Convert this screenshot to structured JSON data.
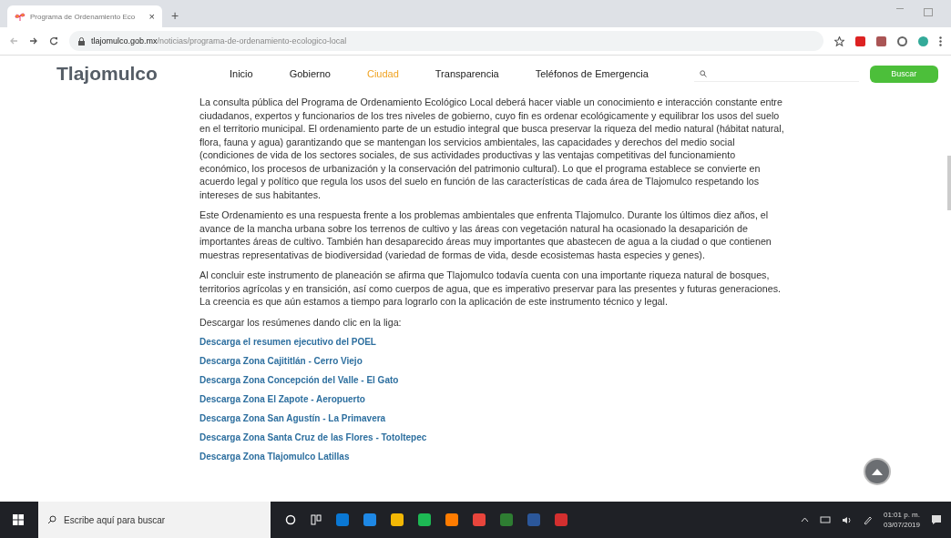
{
  "browser": {
    "tab_title": "Programa de Ordenamiento Eco",
    "tab_close": "×",
    "new_tab": "+",
    "url_domain": "tlajomulco.gob.mx",
    "url_path": "/noticias/programa-de-ordenamiento-ecologico-local"
  },
  "header": {
    "logo": "Tlajomulco",
    "nav": [
      {
        "label": "Inicio",
        "selected": false
      },
      {
        "label": "Gobierno",
        "selected": false
      },
      {
        "label": "Ciudad",
        "selected": true
      },
      {
        "label": "Transparencia",
        "selected": false
      },
      {
        "label": "Teléfonos de Emergencia",
        "selected": false
      }
    ],
    "search_button": "Buscar"
  },
  "article": {
    "paragraphs": [
      " La consulta pública del Programa de Ordenamiento Ecológico Local deberá hacer viable un conocimiento e interacción constante entre ciudadanos, expertos y funcionarios de los tres niveles de gobierno, cuyo fin es ordenar ecológicamente y equilibrar los usos del suelo en el territorio municipal. El ordenamiento parte de un estudio integral que busca preservar la riqueza del medio natural (hábitat natural, flora, fauna y agua) garantizando que se mantengan los servicios ambientales, las capacidades y derechos del medio social (condiciones de vida de los sectores sociales, de sus actividades productivas y las ventajas competitivas del funcionamiento económico, los procesos de urbanización y la conservación del patrimonio cultural). Lo que el programa establece se convierte en acuerdo legal y político que regula los usos del suelo en función de las características de cada área de Tlajomulco respetando los intereses de sus habitantes.",
      "Este Ordenamiento es una respuesta frente a los problemas ambientales que enfrenta Tlajomulco. Durante los últimos diez años, el avance de la mancha urbana sobre los terrenos de cultivo y las áreas con vegetación natural ha ocasionado la desaparición de importantes áreas de cultivo. También han desaparecido áreas muy importantes que abastecen de agua a la ciudad o que contienen muestras representativas de biodiversidad (variedad de formas de vida, desde ecosistemas hasta especies y genes).",
      "Al concluir este instrumento de planeación se afirma que Tlajomulco todavía cuenta con una importante riqueza natural de bosques, territorios agrícolas y en transición, así como cuerpos de agua, que es imperativo preservar para las presentes y futuras generaciones. La creencia es que aún estamos a tiempo para lograrlo con la aplicación de este instrumento técnico y legal.",
      "Descargar los resúmenes dando clic en la liga:"
    ],
    "links": [
      "Descarga el resumen ejecutivo del POEL",
      "Descarga Zona Cajititlán - Cerro Viejo",
      "Descarga Zona Concepción del Valle - El Gato",
      "Descarga Zona El Zapote - Aeropuerto",
      "Descarga Zona San Agustín - La Primavera",
      "Descarga Zona Santa Cruz de las Flores - Totoltepec",
      "Descarga Zona Tlajomulco Latillas"
    ]
  },
  "taskbar": {
    "search_placeholder": "Escribe aquí para buscar",
    "time": "01:01 p. m.",
    "date": "03/07/2019"
  }
}
